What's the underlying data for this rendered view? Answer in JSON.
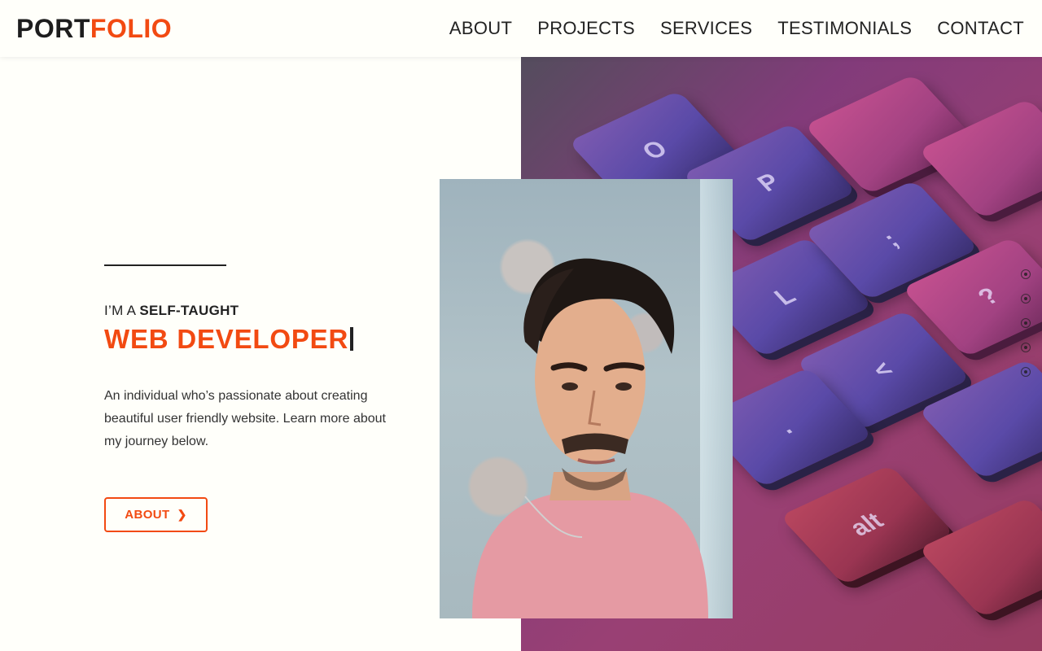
{
  "header": {
    "logo_primary": "PORT",
    "logo_accent": "FOLIO",
    "nav": [
      "ABOUT",
      "PROJECTS",
      "SERVICES",
      "TESTIMONIALS",
      "CONTACT"
    ]
  },
  "hero": {
    "kicker_prefix": "I’M A",
    "kicker_strong": "SELF-TAUGHT",
    "headline": "WEB DEVELOPER",
    "description": "An individual who’s passionate about creating beautiful user friendly website. Learn more about my journey below.",
    "cta_label": "ABOUT",
    "cta_icon": "chevron-right-icon",
    "keyboard_keys": [
      "O",
      "P",
      "L",
      ";",
      "?",
      "/",
      "<",
      ".",
      "alt"
    ]
  },
  "section_dots": {
    "count": 5,
    "icon": "circle-dot-icon"
  },
  "colors": {
    "accent": "#f24a12",
    "text": "#222222",
    "background": "#fffffa"
  }
}
